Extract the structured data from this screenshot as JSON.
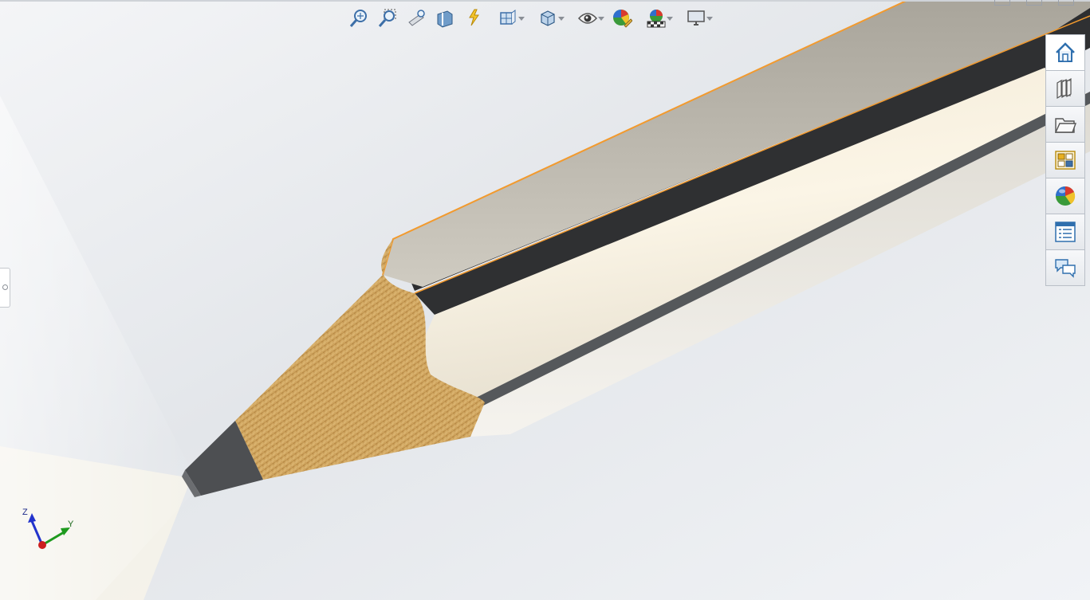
{
  "window": {
    "controls": [
      "minimize",
      "restore",
      "close"
    ]
  },
  "heads_up_toolbar": [
    {
      "name": "zoom-to-fit",
      "icon": "zoom-fit-icon",
      "has_dropdown": false
    },
    {
      "name": "zoom-to-area",
      "icon": "zoom-area-icon",
      "has_dropdown": false
    },
    {
      "name": "previous-view",
      "icon": "previous-view-icon",
      "has_dropdown": false
    },
    {
      "name": "section-view",
      "icon": "section-view-icon",
      "has_dropdown": false
    },
    {
      "name": "dynamic-annotation-views",
      "icon": "dynamic-annotation-icon",
      "has_dropdown": false
    },
    {
      "name": "view-orientation",
      "icon": "view-orientation-icon",
      "has_dropdown": true
    },
    {
      "name": "display-style",
      "icon": "display-style-icon",
      "has_dropdown": true
    },
    {
      "name": "hide-show-items",
      "icon": "eye-icon",
      "has_dropdown": true
    },
    {
      "name": "edit-appearance",
      "icon": "edit-appearance-icon",
      "has_dropdown": false
    },
    {
      "name": "apply-scene",
      "icon": "apply-scene-icon",
      "has_dropdown": true
    },
    {
      "name": "view-settings",
      "icon": "monitor-icon",
      "has_dropdown": true
    }
  ],
  "task_pane": [
    {
      "name": "solidworks-resources",
      "icon": "home-icon"
    },
    {
      "name": "design-library",
      "icon": "library-books-icon"
    },
    {
      "name": "file-explorer",
      "icon": "folder-icon"
    },
    {
      "name": "view-palette",
      "icon": "view-palette-icon"
    },
    {
      "name": "appearances-scenes-decals",
      "icon": "appearance-ball-icon"
    },
    {
      "name": "custom-properties",
      "icon": "custom-properties-icon"
    },
    {
      "name": "solidworks-forum",
      "icon": "forum-chat-icon"
    }
  ],
  "triad": {
    "x_label": "",
    "y_label": "Y",
    "z_label": "Z"
  },
  "colors": {
    "background": "#e9ecf0",
    "pencil_wood": "#c9a15a",
    "pencil_lead": "#4a4b4d",
    "pencil_body": "#efe9dc",
    "edge_highlight": "#f29a2e",
    "axis_z": "#2233cc",
    "axis_y": "#1e9a1e",
    "axis_x": "#cc1f1f"
  }
}
